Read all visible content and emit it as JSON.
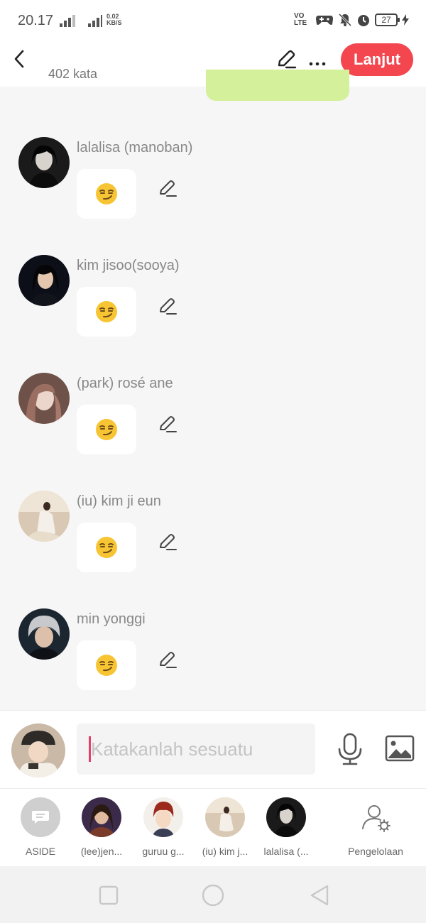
{
  "status_bar": {
    "time": "20.17",
    "net_speed": "0.02",
    "net_unit": "KB/S",
    "signal_tag": "4G",
    "volte": "VO LTE",
    "battery": "27"
  },
  "header": {
    "word_count": "402 kata",
    "next_label": "Lanjut"
  },
  "messages": [
    {
      "name": "lalalisa (manoban)",
      "emoji": "smirking-face"
    },
    {
      "name": "kim jisoo(sooya)",
      "emoji": "smirking-face"
    },
    {
      "name": "(park) rosé ane",
      "emoji": "smirking-face"
    },
    {
      "name": "(iu) kim ji eun",
      "emoji": "smirking-face"
    },
    {
      "name": "min yonggi",
      "emoji": "smirking-face"
    }
  ],
  "composer": {
    "placeholder": "Katakanlah sesuatu",
    "value": ""
  },
  "characters": [
    {
      "label": "ASIDE",
      "icon": "aside-icon"
    },
    {
      "label": "(lee)jen..."
    },
    {
      "label": "guruu g..."
    },
    {
      "label": "(iu) kim j..."
    },
    {
      "label": "lalalisa (..."
    },
    {
      "label": "Pengelolaan",
      "icon": "manage-icon"
    }
  ],
  "colors": {
    "accent": "#f3464f",
    "bubble_green": "#d4f09b",
    "background": "#f6f6f6"
  }
}
